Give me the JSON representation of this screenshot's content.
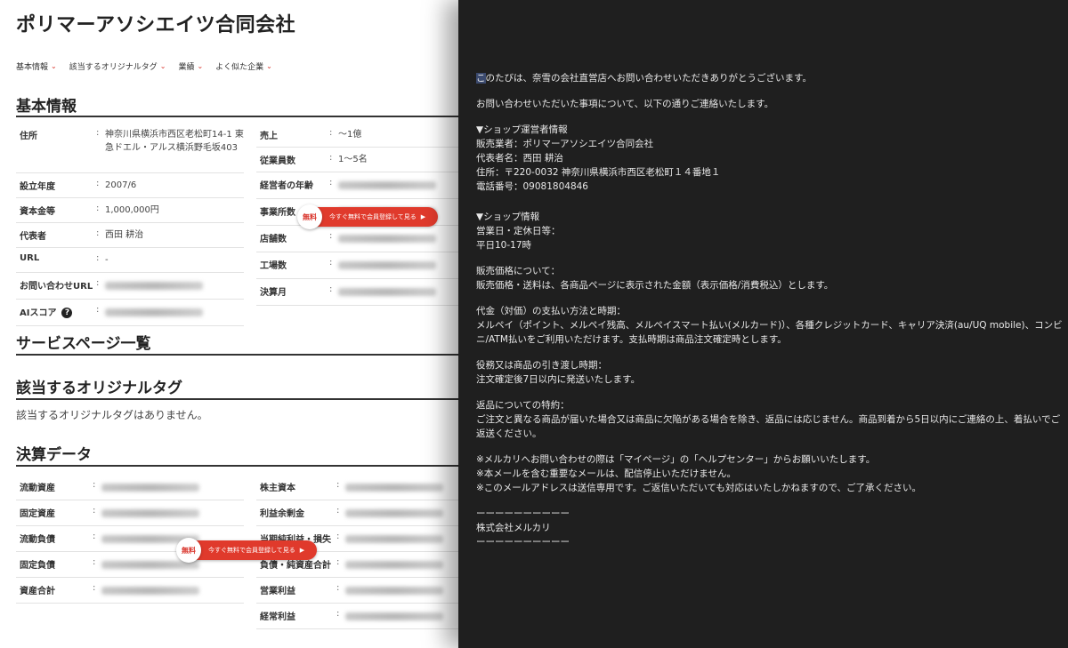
{
  "company": {
    "title": "ポリマーアソシエイツ合同会社"
  },
  "nav": [
    "基本情報",
    "該当するオリジナルタグ",
    "業績",
    "よく似た企業"
  ],
  "sections": {
    "basic": "基本情報",
    "service": "サービスページ一覧",
    "tags": "該当するオリジナルタグ",
    "finance": "決算データ"
  },
  "basic_left": [
    {
      "label": "住所",
      "value": "神奈川県横浜市西区老松町14-1 東急ドエル・アルス横浜野毛坂403"
    },
    {
      "label": "設立年度",
      "value": "2007/6"
    },
    {
      "label": "資本金等",
      "value": "1,000,000円"
    },
    {
      "label": "代表者",
      "value": "西田 耕治"
    },
    {
      "label": "URL",
      "value": "-"
    },
    {
      "label": "お問い合わせURL",
      "value": ""
    },
    {
      "label": "AIスコア",
      "value": ""
    }
  ],
  "basic_right": [
    {
      "label": "売上",
      "value": "〜1億"
    },
    {
      "label": "従業員数",
      "value": "1〜5名"
    },
    {
      "label": "経営者の年齢",
      "value": ""
    },
    {
      "label": "事業所数",
      "value": ""
    },
    {
      "label": "店舗数",
      "value": ""
    },
    {
      "label": "工場数",
      "value": ""
    },
    {
      "label": "決算月",
      "value": ""
    }
  ],
  "ai_icon": "?",
  "tags_empty": "該当するオリジナルタグはありません。",
  "cta": {
    "free": "無料",
    "label": "今すぐ無料で会員登録して見る",
    "arrow": "▶"
  },
  "finance_left": [
    "流動資産",
    "固定資産",
    "流動負債",
    "固定負債",
    "資産合計"
  ],
  "finance_right": [
    "株主資本",
    "利益余剰金",
    "当期純利益・損失",
    "負債・純資産合計",
    "営業利益",
    "経常利益"
  ],
  "mail": {
    "greeting_first_char": "こ",
    "greeting_rest": "のたびは、奈雪の会社直営店へお問い合わせいただきありがとうございます。",
    "intro": "お問い合わせいただいた事項について、以下の通りご連絡いたします。",
    "operator_block": "▼ショップ運営者情報\n販売業者：ポリマーアソシエイツ合同会社\n代表者名：西田 耕治\n住所：〒220-0032 神奈川県横浜市西区老松町１４番地１\n電話番号：09081804846",
    "shop_block": "▼ショップ情報\n営業日・定休日等：\n平日10-17時",
    "price_block": "販売価格について：\n販売価格・送料は、各商品ページに表示された金額（表示価格/消費税込）とします。",
    "payment_block": "代金（対価）の支払い方法と時期：\nメルペイ（ポイント、メルペイ残高、メルペイスマート払い(メルカード)）、各種クレジットカード、キャリア決済(au/UQ mobile)、コンビニ/ATM払いをご利用いただけます。支払時期は商品注文確定時とします。",
    "delivery_block": "役務又は商品の引き渡し時期：\n注文確定後7日以内に発送いたします。",
    "return_block": "返品についての特約：\nご注文と異なる商品が届いた場合又は商品に欠陥がある場合を除き、返品には応じません。商品到着から5日以内にご連絡の上、着払いでご返送ください。",
    "notes_block": "※メルカリへお問い合わせの際は「マイページ」の「ヘルプセンター」からお願いいたします。\n※本メールを含む重要なメールは、配信停止いただけません。\n※このメールアドレスは送信専用です。ご返信いただいても対応はいたしかねますので、ご了承ください。",
    "footer_block": "ーーーーーーーーーー\n株式会社メルカリ\nーーーーーーーーーー"
  },
  "colors": {
    "accent": "#e03a2c",
    "mail_bg": "#1f1f1f",
    "mail_text": "#e8e8e8"
  }
}
